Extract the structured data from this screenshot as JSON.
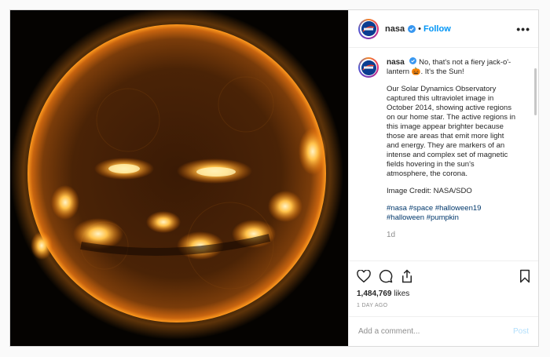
{
  "account": {
    "username": "nasa",
    "follow_label": "Follow",
    "separator": "•",
    "more_label": "•••"
  },
  "caption": {
    "username": "nasa",
    "line1": "No, that's not a fiery jack-o'-lantern 🎃. It's the Sun!",
    "paragraph": "Our Solar Dynamics Observatory captured this ultraviolet image in October 2014, showing active regions on our home star. The active regions in this image appear brighter because those are areas that emit more light and energy. They are markers of an intense and complex set of magnetic fields hovering in the sun's atmosphere, the corona.",
    "credit": "Image Credit: NASA/SDO",
    "hashtags": [
      "#nasa",
      "#space",
      "#halloween19",
      "#halloween",
      "#pumpkin"
    ],
    "time": "1d"
  },
  "engagement": {
    "likes_count": "1,484,769",
    "likes_word": "likes",
    "posted_ago": "1 DAY AGO"
  },
  "comment": {
    "placeholder": "Add a comment...",
    "post_label": "Post"
  },
  "colors": {
    "accent": "#0095f6",
    "verified": "#3897f0",
    "hashtag": "#00376b",
    "post_disabled": "#b2dffc"
  }
}
